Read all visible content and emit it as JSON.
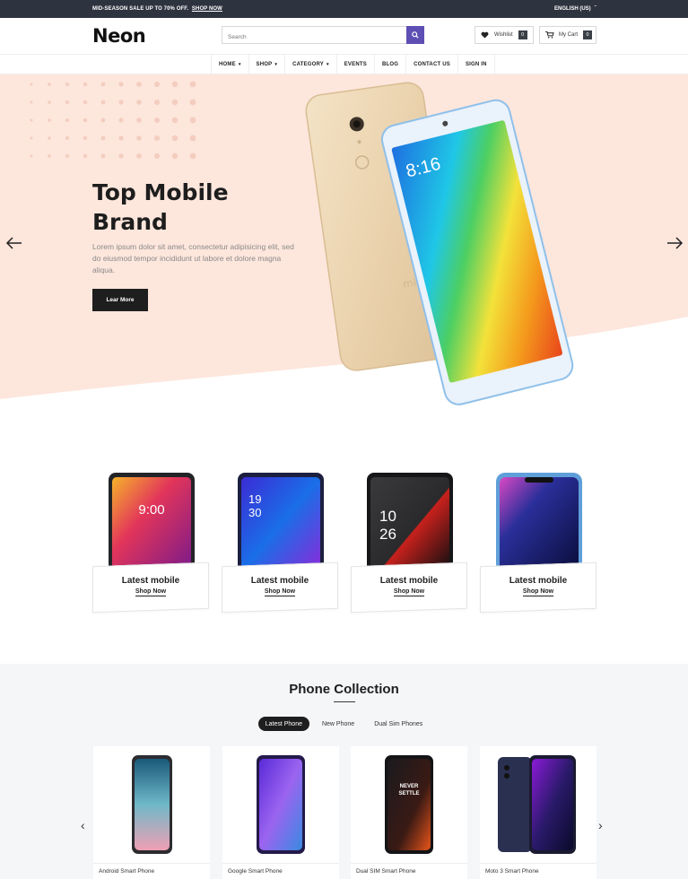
{
  "topbar": {
    "promo": "MID-SEASON SALE UP TO 70% OFF.",
    "promo_link": "SHOP NOW",
    "language": "ENGLISH (US)"
  },
  "header": {
    "logo": "Neon",
    "search_placeholder": "Search",
    "wishlist_label": "Wishlist",
    "wishlist_count": "0",
    "cart_label": "My Cart",
    "cart_count": "0"
  },
  "nav": {
    "items": [
      {
        "label": "HOME",
        "dropdown": true
      },
      {
        "label": "SHOP",
        "dropdown": true
      },
      {
        "label": "CATEGORY",
        "dropdown": true
      },
      {
        "label": "EVENTS",
        "dropdown": false
      },
      {
        "label": "BLOG",
        "dropdown": false
      },
      {
        "label": "CONTACT US",
        "dropdown": false
      },
      {
        "label": "SIGN IN",
        "dropdown": false
      }
    ]
  },
  "hero": {
    "title_line1": "Top Mobile",
    "title_line2": "Brand",
    "description": "Lorem ipsum dolor sit amet, consectetur adipisicing elit, sed do eiusmod tempor incididunt ut labore et dolore magna aliqua.",
    "button": "Lear More",
    "phone_time": "8:16"
  },
  "categories": [
    {
      "title": "Latest mobile",
      "link": "Shop Now",
      "screen_text": "9:00"
    },
    {
      "title": "Latest mobile",
      "link": "Shop Now",
      "screen_text": "19\n30"
    },
    {
      "title": "Latest mobile",
      "link": "Shop Now",
      "screen_text": "10\n26"
    },
    {
      "title": "Latest mobile",
      "link": "Shop Now",
      "screen_text": ""
    }
  ],
  "collection": {
    "title": "Phone Collection",
    "tabs": [
      {
        "label": "Latest Phone",
        "active": true
      },
      {
        "label": "New Phone",
        "active": false
      },
      {
        "label": "Dual Sim Phones",
        "active": false
      }
    ],
    "products": [
      {
        "name": "Android Smart Phone"
      },
      {
        "name": "Google Smart Phone"
      },
      {
        "name": "Dual SIM Smart Phone",
        "screen_text": "NEVER SETTLE"
      },
      {
        "name": "Moto 3 Smart Phone"
      }
    ]
  },
  "colors": {
    "topbar_bg": "#2e3340",
    "accent": "#5e4fb4",
    "hero_bg": "#fde6dc",
    "dark_button": "#1e1e1e"
  }
}
